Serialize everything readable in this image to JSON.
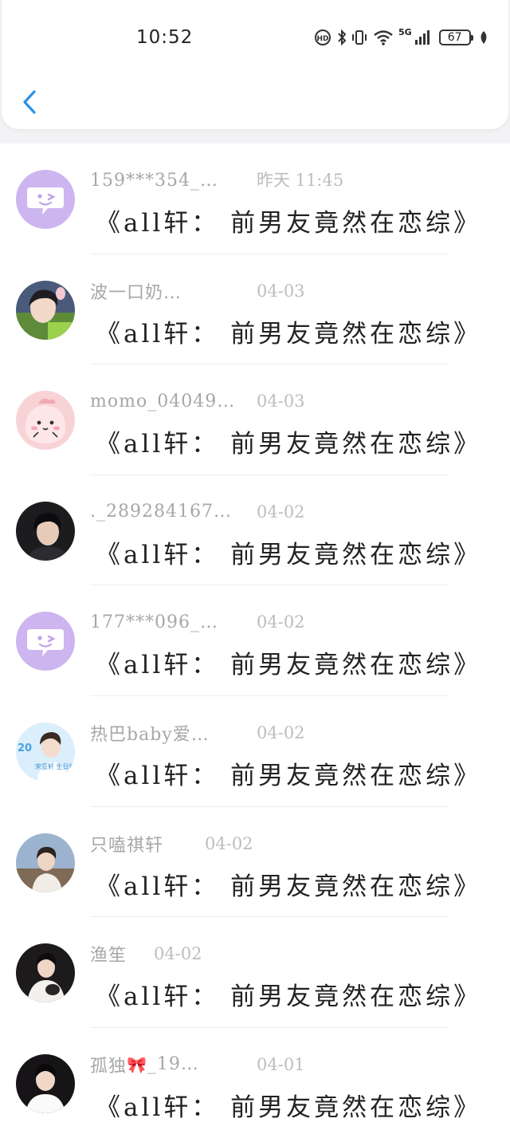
{
  "status_bar": {
    "time": "10:52",
    "network": "5G",
    "battery": "67"
  },
  "messages": [
    {
      "avatar": "app-default-avatar",
      "name": "159***354_…",
      "time": "昨天 11:45",
      "text": "《all轩： 前男友竟然在恋综》"
    },
    {
      "avatar": "user-photo-avatar",
      "name": "波一口奶…",
      "time": "04-03",
      "text": "《all轩： 前男友竟然在恋综》"
    },
    {
      "avatar": "pink-cartoon-avatar",
      "name": "momo_04049…",
      "time": "04-03",
      "text": "《all轩： 前男友竟然在恋综》"
    },
    {
      "avatar": "user-photo-avatar",
      "name": "._289284167…",
      "time": "04-02",
      "text": "《all轩： 前男友竟然在恋综》"
    },
    {
      "avatar": "app-default-avatar",
      "name": "177***096_…",
      "time": "04-02",
      "text": "《all轩： 前男友竟然在恋综》"
    },
    {
      "avatar": "birthday-poster-avatar",
      "name": "热巴baby爱…",
      "time": "04-02",
      "text": "《all轩： 前男友竟然在恋综》",
      "avatar_text": "宋亚轩 生日快乐"
    },
    {
      "avatar": "user-photo-avatar",
      "name": "只嗑祺轩",
      "time": "04-02",
      "text": "《all轩： 前男友竟然在恋综》"
    },
    {
      "avatar": "user-photo-avatar",
      "name": "渔笙",
      "time": "04-02",
      "text": "《all轩： 前男友竟然在恋综》"
    },
    {
      "avatar": "user-photo-avatar",
      "name": "孤独",
      "name_emoji": "🎀",
      "name_suffix": "_19…",
      "time": "04-01",
      "text": "《all轩： 前男友竟然在恋综》"
    }
  ],
  "colors": {
    "accent": "#1e88e5",
    "purple_avatar": "#cdb5f0",
    "pink_avatar": "#f8d3d6"
  }
}
